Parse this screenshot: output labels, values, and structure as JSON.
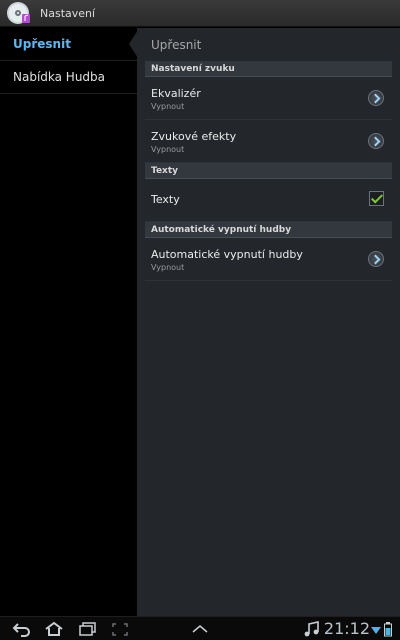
{
  "titlebar": {
    "title": "Nastavení",
    "icon": "music-disc-icon"
  },
  "sidebar": {
    "items": [
      {
        "label": "Upřesnit",
        "active": true
      },
      {
        "label": "Nabídka Hudba",
        "active": false
      }
    ]
  },
  "panel": {
    "title": "Upřesnit",
    "sections": [
      {
        "header": "Nastavení zvuku",
        "rows": [
          {
            "label": "Ekvalizér",
            "value": "Vypnout"
          },
          {
            "label": "Zvukové efekty",
            "value": "Vypnout"
          }
        ]
      },
      {
        "header": "Texty",
        "rows": [
          {
            "label": "Texty",
            "checked": true
          }
        ]
      },
      {
        "header": "Automatické vypnutí hudby",
        "rows": [
          {
            "label": "Automatické vypnutí hudby",
            "value": "Vypnout"
          }
        ]
      }
    ]
  },
  "statusbar": {
    "time": "21:12",
    "icons": [
      "back-icon",
      "home-icon",
      "recent-apps-icon",
      "screenshot-icon",
      "up-arrow-icon",
      "music-note-icon",
      "wifi-icon",
      "battery-icon"
    ]
  },
  "colors": {
    "accent": "#5db8f0",
    "panel": "#23262b",
    "check": "#7ec83a"
  }
}
